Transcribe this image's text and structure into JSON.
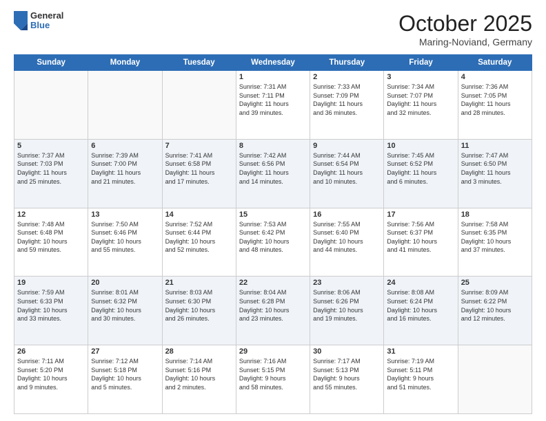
{
  "header": {
    "logo_general": "General",
    "logo_blue": "Blue",
    "month_title": "October 2025",
    "location": "Maring-Noviand, Germany"
  },
  "days_of_week": [
    "Sunday",
    "Monday",
    "Tuesday",
    "Wednesday",
    "Thursday",
    "Friday",
    "Saturday"
  ],
  "weeks": [
    {
      "alt": false,
      "days": [
        {
          "num": "",
          "content": ""
        },
        {
          "num": "",
          "content": ""
        },
        {
          "num": "",
          "content": ""
        },
        {
          "num": "1",
          "content": "Sunrise: 7:31 AM\nSunset: 7:11 PM\nDaylight: 11 hours\nand 39 minutes."
        },
        {
          "num": "2",
          "content": "Sunrise: 7:33 AM\nSunset: 7:09 PM\nDaylight: 11 hours\nand 36 minutes."
        },
        {
          "num": "3",
          "content": "Sunrise: 7:34 AM\nSunset: 7:07 PM\nDaylight: 11 hours\nand 32 minutes."
        },
        {
          "num": "4",
          "content": "Sunrise: 7:36 AM\nSunset: 7:05 PM\nDaylight: 11 hours\nand 28 minutes."
        }
      ]
    },
    {
      "alt": true,
      "days": [
        {
          "num": "5",
          "content": "Sunrise: 7:37 AM\nSunset: 7:03 PM\nDaylight: 11 hours\nand 25 minutes."
        },
        {
          "num": "6",
          "content": "Sunrise: 7:39 AM\nSunset: 7:00 PM\nDaylight: 11 hours\nand 21 minutes."
        },
        {
          "num": "7",
          "content": "Sunrise: 7:41 AM\nSunset: 6:58 PM\nDaylight: 11 hours\nand 17 minutes."
        },
        {
          "num": "8",
          "content": "Sunrise: 7:42 AM\nSunset: 6:56 PM\nDaylight: 11 hours\nand 14 minutes."
        },
        {
          "num": "9",
          "content": "Sunrise: 7:44 AM\nSunset: 6:54 PM\nDaylight: 11 hours\nand 10 minutes."
        },
        {
          "num": "10",
          "content": "Sunrise: 7:45 AM\nSunset: 6:52 PM\nDaylight: 11 hours\nand 6 minutes."
        },
        {
          "num": "11",
          "content": "Sunrise: 7:47 AM\nSunset: 6:50 PM\nDaylight: 11 hours\nand 3 minutes."
        }
      ]
    },
    {
      "alt": false,
      "days": [
        {
          "num": "12",
          "content": "Sunrise: 7:48 AM\nSunset: 6:48 PM\nDaylight: 10 hours\nand 59 minutes."
        },
        {
          "num": "13",
          "content": "Sunrise: 7:50 AM\nSunset: 6:46 PM\nDaylight: 10 hours\nand 55 minutes."
        },
        {
          "num": "14",
          "content": "Sunrise: 7:52 AM\nSunset: 6:44 PM\nDaylight: 10 hours\nand 52 minutes."
        },
        {
          "num": "15",
          "content": "Sunrise: 7:53 AM\nSunset: 6:42 PM\nDaylight: 10 hours\nand 48 minutes."
        },
        {
          "num": "16",
          "content": "Sunrise: 7:55 AM\nSunset: 6:40 PM\nDaylight: 10 hours\nand 44 minutes."
        },
        {
          "num": "17",
          "content": "Sunrise: 7:56 AM\nSunset: 6:37 PM\nDaylight: 10 hours\nand 41 minutes."
        },
        {
          "num": "18",
          "content": "Sunrise: 7:58 AM\nSunset: 6:35 PM\nDaylight: 10 hours\nand 37 minutes."
        }
      ]
    },
    {
      "alt": true,
      "days": [
        {
          "num": "19",
          "content": "Sunrise: 7:59 AM\nSunset: 6:33 PM\nDaylight: 10 hours\nand 33 minutes."
        },
        {
          "num": "20",
          "content": "Sunrise: 8:01 AM\nSunset: 6:32 PM\nDaylight: 10 hours\nand 30 minutes."
        },
        {
          "num": "21",
          "content": "Sunrise: 8:03 AM\nSunset: 6:30 PM\nDaylight: 10 hours\nand 26 minutes."
        },
        {
          "num": "22",
          "content": "Sunrise: 8:04 AM\nSunset: 6:28 PM\nDaylight: 10 hours\nand 23 minutes."
        },
        {
          "num": "23",
          "content": "Sunrise: 8:06 AM\nSunset: 6:26 PM\nDaylight: 10 hours\nand 19 minutes."
        },
        {
          "num": "24",
          "content": "Sunrise: 8:08 AM\nSunset: 6:24 PM\nDaylight: 10 hours\nand 16 minutes."
        },
        {
          "num": "25",
          "content": "Sunrise: 8:09 AM\nSunset: 6:22 PM\nDaylight: 10 hours\nand 12 minutes."
        }
      ]
    },
    {
      "alt": false,
      "days": [
        {
          "num": "26",
          "content": "Sunrise: 7:11 AM\nSunset: 5:20 PM\nDaylight: 10 hours\nand 9 minutes."
        },
        {
          "num": "27",
          "content": "Sunrise: 7:12 AM\nSunset: 5:18 PM\nDaylight: 10 hours\nand 5 minutes."
        },
        {
          "num": "28",
          "content": "Sunrise: 7:14 AM\nSunset: 5:16 PM\nDaylight: 10 hours\nand 2 minutes."
        },
        {
          "num": "29",
          "content": "Sunrise: 7:16 AM\nSunset: 5:15 PM\nDaylight: 9 hours\nand 58 minutes."
        },
        {
          "num": "30",
          "content": "Sunrise: 7:17 AM\nSunset: 5:13 PM\nDaylight: 9 hours\nand 55 minutes."
        },
        {
          "num": "31",
          "content": "Sunrise: 7:19 AM\nSunset: 5:11 PM\nDaylight: 9 hours\nand 51 minutes."
        },
        {
          "num": "",
          "content": ""
        }
      ]
    }
  ]
}
